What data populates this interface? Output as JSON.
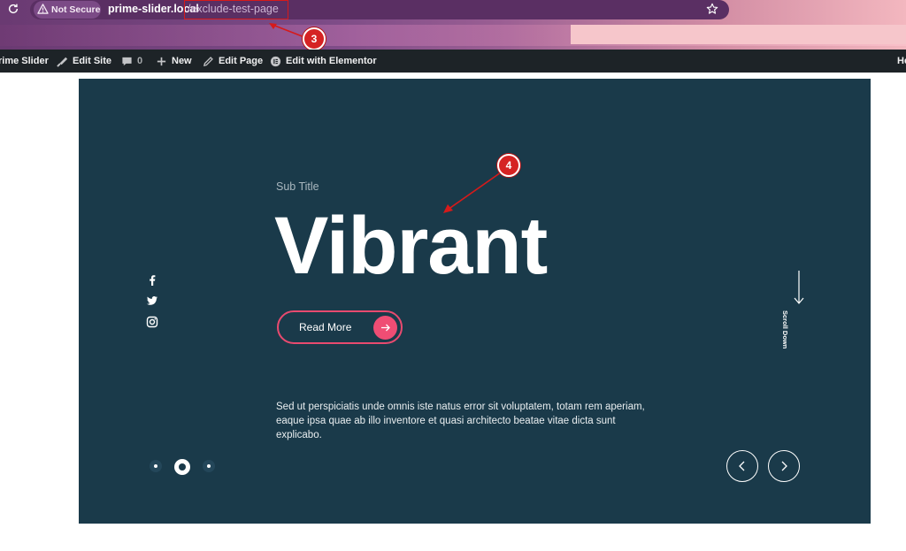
{
  "browser": {
    "security_label": "Not Secure",
    "url_host": "prime-slider.local",
    "url_path": "/exclude-test-page"
  },
  "annotations": {
    "address_marker": "3",
    "heading_marker": "4"
  },
  "admin_bar": {
    "site_name": "rime Slider",
    "edit_site": "Edit Site",
    "comments_count": "0",
    "new_label": "New",
    "edit_page": "Edit Page",
    "edit_with_elementor": "Edit with Elementor",
    "right_truncated": "He"
  },
  "slider": {
    "subtitle": "Sub Title",
    "title": "Vibrant",
    "button_label": "Read More",
    "description": "Sed ut perspiciatis unde omnis iste natus error sit voluptatem, totam rem aperiam, eaque ipsa quae ab illo inventore et quasi architecto beatae vitae dicta sunt explicabo.",
    "scroll_label": "Scroll Down",
    "active_slide": 2,
    "total_slides": 3,
    "social_icons": [
      "facebook-icon",
      "twitter-icon",
      "instagram-icon"
    ]
  },
  "colors": {
    "slide_background": "#1a3a4a",
    "accent": "#ef4d74",
    "admin_bar": "#1d2327"
  }
}
